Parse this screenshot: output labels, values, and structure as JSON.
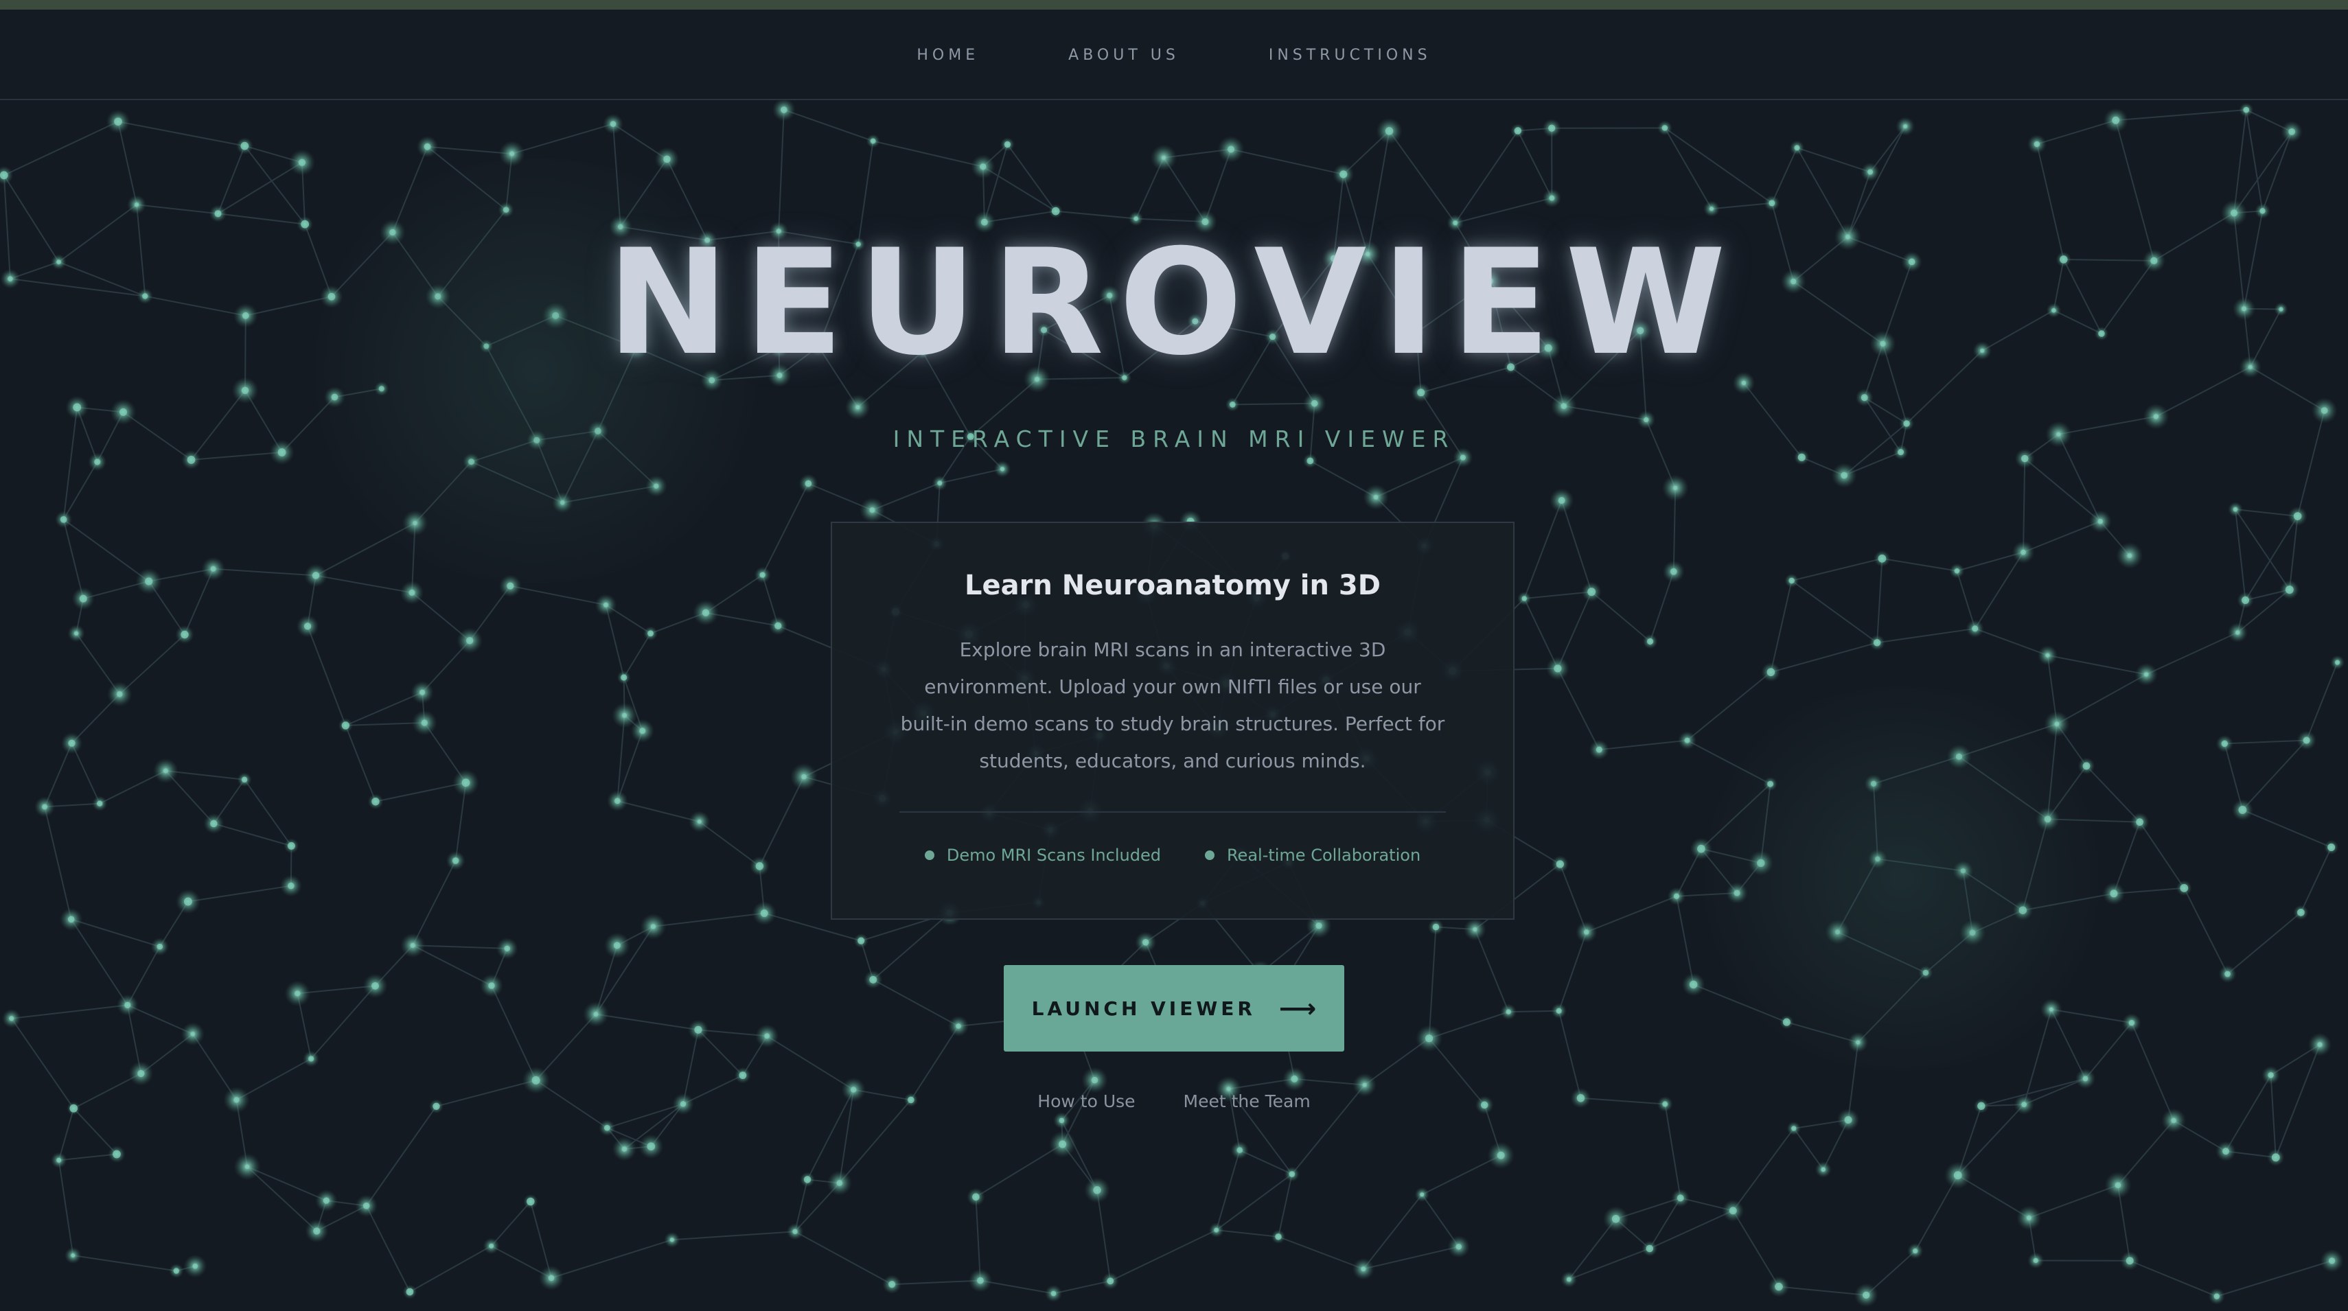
{
  "nav": {
    "items": [
      {
        "label": "HOME"
      },
      {
        "label": "ABOUT US"
      },
      {
        "label": "INSTRUCTIONS"
      }
    ]
  },
  "hero": {
    "title": "NEUROVIEW",
    "subtitle": "INTERACTIVE BRAIN MRI VIEWER"
  },
  "card": {
    "title": "Learn Neuroanatomy in 3D",
    "description": "Explore brain MRI scans in an interactive 3D environment. Upload your own NIfTI files or use our built-in demo scans to study brain structures. Perfect for students, educators, and curious minds.",
    "features": [
      {
        "label": "Demo MRI Scans Included"
      },
      {
        "label": "Real-time Collaboration"
      }
    ]
  },
  "cta": {
    "label": "LAUNCH VIEWER",
    "arrow": "⟶"
  },
  "links": [
    {
      "label": "How to Use"
    },
    {
      "label": "Meet the Team"
    }
  ],
  "colors": {
    "background": "#141a22",
    "accent": "#69a797",
    "title": "#ccd3de",
    "node": "#7cc9b3"
  },
  "icons": {
    "cta_arrow": "arrow-right-icon",
    "feature_bullet": "dot-icon"
  }
}
